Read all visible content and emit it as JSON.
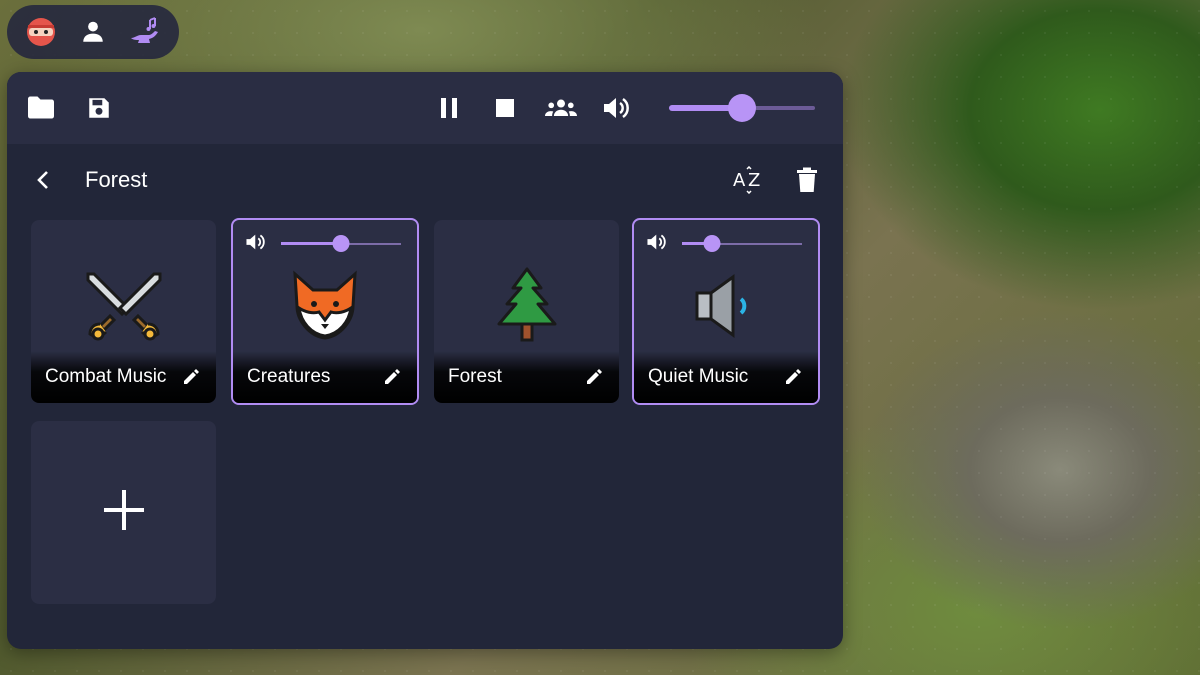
{
  "mini_toolbar": {
    "items": [
      {
        "icon": "ninja-avatar-icon"
      },
      {
        "icon": "person-icon"
      },
      {
        "icon": "magic-lamp-music-icon"
      }
    ]
  },
  "toolbar": {
    "left_icons": [
      "folder-icon",
      "save-icon"
    ],
    "right_icons": [
      "pause-icon",
      "stop-icon",
      "group-icon",
      "volume-icon"
    ],
    "master_volume": 0.5
  },
  "header": {
    "back_icon": "chevron-left-icon",
    "title": "Forest",
    "sort_icon": "sort-az-icon",
    "delete_icon": "trash-icon"
  },
  "tiles": [
    {
      "label": "Combat Music",
      "emoji": "⚔️",
      "playing": false
    },
    {
      "label": "Creatures",
      "emoji": "🦊",
      "playing": true,
      "volume": 0.5
    },
    {
      "label": "Forest",
      "emoji": "🌲",
      "playing": false
    },
    {
      "label": "Quiet Music",
      "emoji": "🔈",
      "playing": true,
      "volume": 0.25
    }
  ],
  "add_tile": {
    "icon": "plus-icon"
  },
  "colors": {
    "accent": "#b18cf3",
    "panel": "#222639",
    "toolbar": "#2a2d43",
    "tile": "#2b2e44"
  }
}
